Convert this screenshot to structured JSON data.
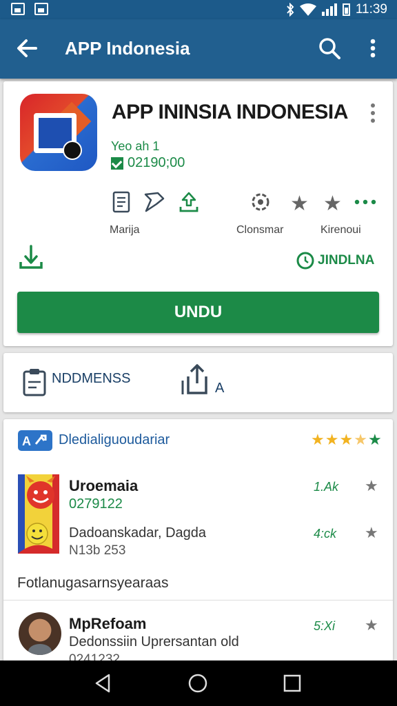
{
  "status_bar": {
    "time": "11:39"
  },
  "app_bar": {
    "title": "APP Indonesia"
  },
  "app": {
    "name": "APP  ININSIA INDONESIA",
    "developer": "Yeo ah 1",
    "id_text": "02190;00",
    "meta": [
      {
        "label": "Marija"
      },
      {
        "label": "Clonsmar"
      },
      {
        "label": "Kirenoui"
      }
    ],
    "download_status": "JINDLNA",
    "install_label": "UNDU"
  },
  "links": {
    "item1": "NDDMENSS",
    "item2": "A"
  },
  "list": {
    "header": "Dledialiguoudariar",
    "rows": [
      {
        "name": "Uroemaia",
        "sub": "0279122",
        "stat": "1.Ak"
      },
      {
        "text": "Dadoanskadar, Dagda",
        "meta": "N13b 253",
        "stat": "4:ck"
      }
    ],
    "section_title": "Fotlanugasarnsyearaas",
    "person": {
      "name": "MpRefoam",
      "text": "Dedonssiin Uprersantan old",
      "meta": "0241232",
      "stat": "5:Xi"
    }
  },
  "colors": {
    "primary": "#215f8f",
    "accent_green": "#1c8a47",
    "star": "#f2b321"
  },
  "icons": [
    "back-arrow-icon",
    "search-icon",
    "more-vert-icon",
    "document-icon",
    "pin-icon",
    "download-icon",
    "badge-icon",
    "star-icon",
    "more-horiz-icon",
    "clipboard-icon",
    "share-icon",
    "clock-icon"
  ]
}
